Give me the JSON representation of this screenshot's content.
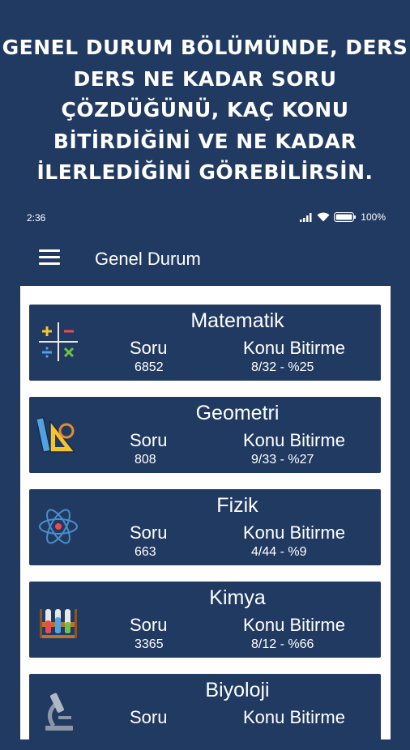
{
  "promo": {
    "lines": [
      "GENEL DURUM BÖLÜMÜNDE, DERS",
      "DERS NE KADAR SORU",
      "ÇÖZDÜĞÜNÜ, KAÇ KONU",
      "BİTİRDİĞİNİ VE NE KADAR",
      "İLERLEDİĞİNİ GÖREBİLİRSİN."
    ]
  },
  "status_bar": {
    "time": "2:36",
    "battery": "100%"
  },
  "app_bar": {
    "title": "Genel Durum",
    "menu_icon": "hamburger-menu-icon"
  },
  "subjects": [
    {
      "name": "Matematik",
      "soru_label": "Soru",
      "konu_label": "Konu Bitirme",
      "soru": "6852",
      "konu": "8/32 - %25",
      "icon": "math-symbols-icon"
    },
    {
      "name": "Geometri",
      "soru_label": "Soru",
      "konu_label": "Konu Bitirme",
      "soru": "808",
      "konu": "9/33 - %27",
      "icon": "ruler-triangle-icon"
    },
    {
      "name": "Fizik",
      "soru_label": "Soru",
      "konu_label": "Konu Bitirme",
      "soru": "663",
      "konu": "4/44 - %9",
      "icon": "atom-icon"
    },
    {
      "name": "Kimya",
      "soru_label": "Soru",
      "konu_label": "Konu Bitirme",
      "soru": "3365",
      "konu": "8/12 - %66",
      "icon": "test-tubes-icon"
    },
    {
      "name": "Biyoloji",
      "soru_label": "Soru",
      "konu_label": "Konu Bitirme",
      "soru": "",
      "konu": "",
      "icon": "microscope-icon"
    }
  ],
  "colors": {
    "background": "#213a62",
    "card": "#213a62",
    "panel": "#ffffff"
  }
}
